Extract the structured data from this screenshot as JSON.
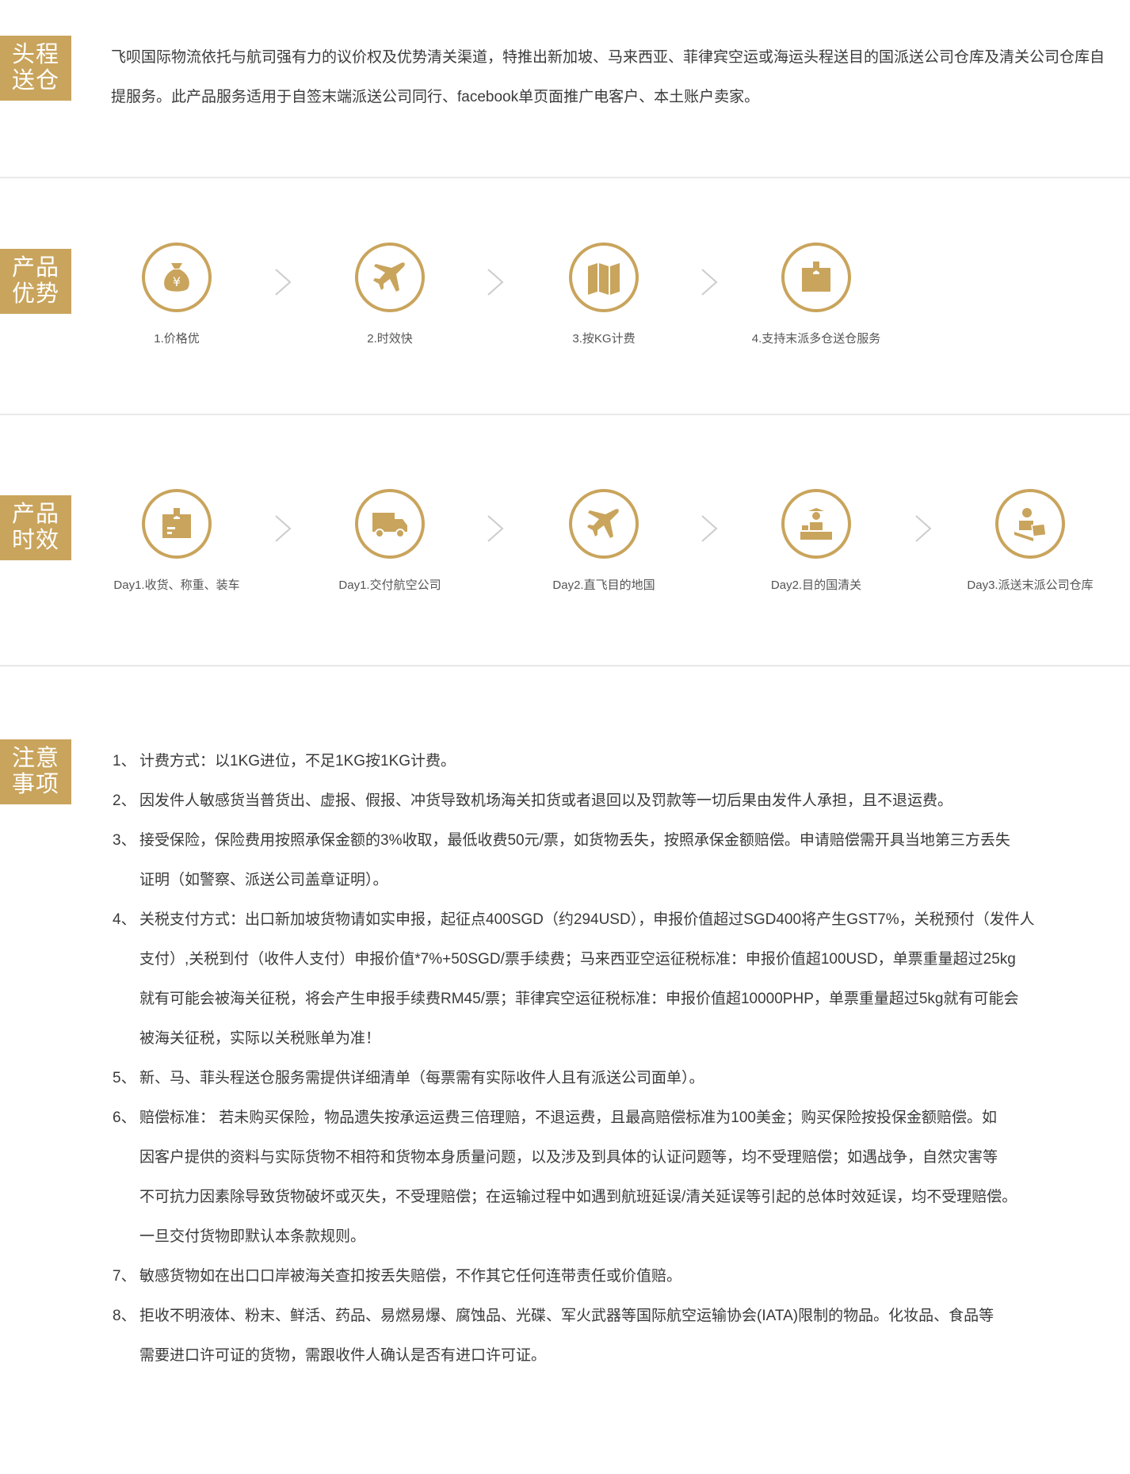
{
  "section1": {
    "tag": [
      "头程",
      "送仓"
    ],
    "intro": "飞呗国际物流依托与航司强有力的议价权及优势清关渠道，特推出新加坡、马来西亚、菲律宾空运或海运头程送目的国派送公司仓库及清关公司仓库自提服务。此产品服务适用于自签末端派送公司同行、facebook单页面推广电客户、本土账户卖家。"
  },
  "section2": {
    "tag": [
      "产品",
      "优势"
    ],
    "steps": [
      {
        "icon": "money-bag-icon",
        "label": "1.价格优"
      },
      {
        "icon": "airplane-icon",
        "label": "2.时效快"
      },
      {
        "icon": "map-icon",
        "label": "3.按KG计费"
      },
      {
        "icon": "box-icon",
        "label": "4.支持末派多仓送仓服务"
      }
    ]
  },
  "section3": {
    "tag": [
      "产品",
      "时效"
    ],
    "steps": [
      {
        "icon": "package-icon",
        "label": "Day1.收货、称重、装车"
      },
      {
        "icon": "truck-icon",
        "label": "Day1.交付航空公司"
      },
      {
        "icon": "airplane-icon",
        "label": "Day2.直飞目的地国"
      },
      {
        "icon": "customs-officer-icon",
        "label": "Day2.目的国清关"
      },
      {
        "icon": "delivery-person-icon",
        "label": "Day3.派送末派公司仓库"
      }
    ]
  },
  "section4": {
    "tag": [
      "注意",
      "事项"
    ],
    "notes": [
      {
        "num": "1、",
        "lines": [
          "计费方式：以1KG进位，不足1KG按1KG计费。"
        ]
      },
      {
        "num": "2、",
        "lines": [
          "因发件人敏感货当普货出、虚报、假报、冲货导致机场海关扣货或者退回以及罚款等一切后果由发件人承担，且不退运费。"
        ]
      },
      {
        "num": "3、",
        "lines": [
          "接受保险，保险费用按照承保金额的3%收取，最低收费50元/票，如货物丢失，按照承保金额赔偿。申请赔偿需开具当地第三方丢失",
          "证明（如警察、派送公司盖章证明）。"
        ]
      },
      {
        "num": "4、",
        "lines": [
          "关税支付方式：出口新加坡货物请如实申报，起征点400SGD（约294USD），申报价值超过SGD400将产生GST7%，关税预付（发件人",
          "支付）,关税到付（收件人支付）申报价值*7%+50SGD/票手续费；马来西亚空运征税标准：申报价值超100USD，单票重量超过25kg",
          "就有可能会被海关征税，将会产生申报手续费RM45/票；菲律宾空运征税标准：申报价值超10000PHP，单票重量超过5kg就有可能会",
          "被海关征税，实际以关税账单为准！"
        ]
      },
      {
        "num": "5、",
        "lines": [
          "新、马、菲头程送仓服务需提供详细清单（每票需有实际收件人且有派送公司面单）。"
        ]
      },
      {
        "num": "6、",
        "lines": [
          "赔偿标准： 若未购买保险，物品遗失按承运运费三倍理赔，不退运费，且最高赔偿标准为100美金；购买保险按投保金额赔偿。如",
          "因客户提供的资料与实际货物不相符和货物本身质量问题，以及涉及到具体的认证问题等，均不受理赔偿；如遇战争，自然灾害等",
          "不可抗力因素除导致货物破坏或灭失，不受理赔偿；在运输过程中如遇到航班延误/清关延误等引起的总体时效延误，均不受理赔偿。",
          "一旦交付货物即默认本条款规则。"
        ]
      },
      {
        "num": "7、",
        "lines": [
          "敏感货物如在出口口岸被海关查扣按丢失赔偿，不作其它任何连带责任或价值赔。"
        ]
      },
      {
        "num": "8、",
        "lines": [
          "拒收不明液体、粉末、鲜活、药品、易燃易爆、腐蚀品、光碟、军火武器等国际航空运输协会(IATA)限制的物品。化妆品、食品等",
          "需要进口许可证的货物，需跟收件人确认是否有进口许可证。"
        ]
      }
    ]
  },
  "colors": {
    "accent": "#c9a45c",
    "divider": "#e8e8e8"
  }
}
